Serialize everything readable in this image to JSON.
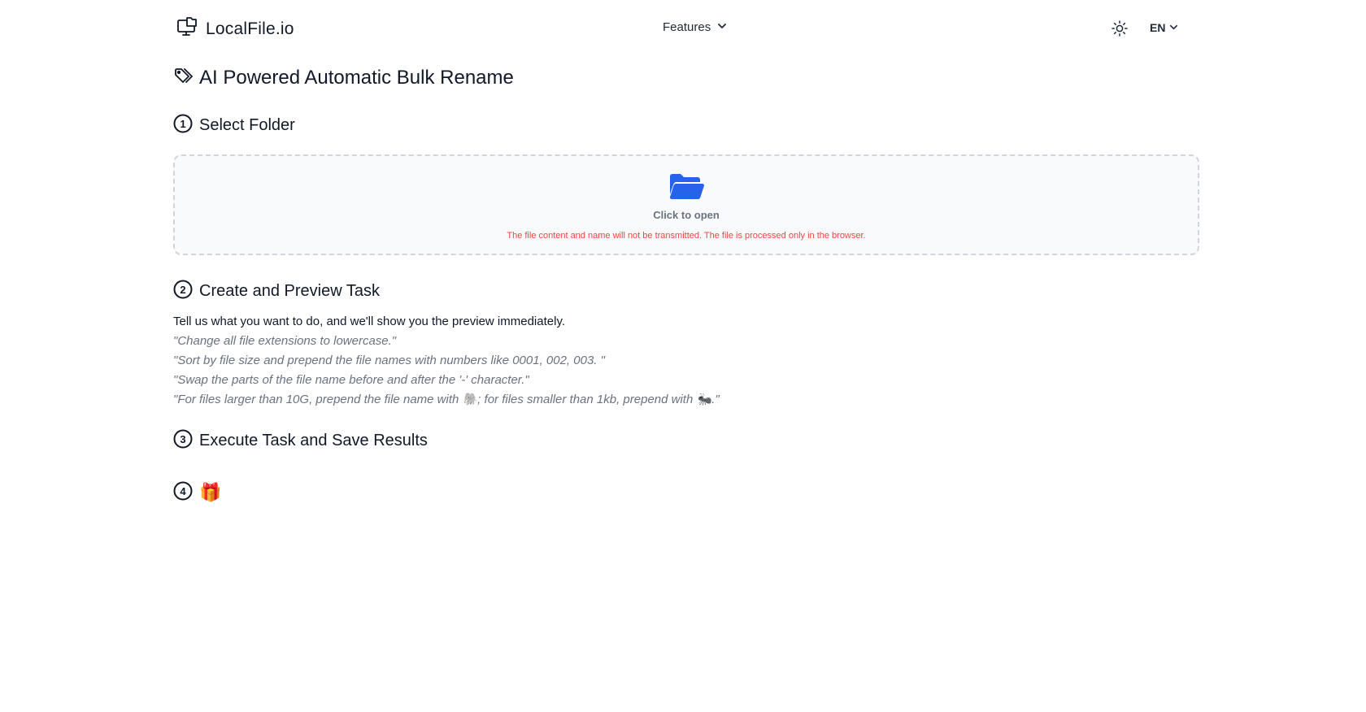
{
  "header": {
    "logo_text": "LocalFile.io",
    "nav_features": "Features",
    "language": "EN"
  },
  "page": {
    "title": "AI Powered Automatic Bulk Rename"
  },
  "steps": [
    {
      "number": "1",
      "label": "Select Folder"
    },
    {
      "number": "2",
      "label": "Create and Preview Task"
    },
    {
      "number": "3",
      "label": "Execute Task and Save Results"
    },
    {
      "number": "4",
      "label": "🎁"
    }
  ],
  "dropzone": {
    "click_text": "Click to open",
    "privacy_note": "The file content and name will not be transmitted. The file is processed only in the browser."
  },
  "task": {
    "intro": "Tell us what you want to do, and we'll show you the preview immediately.",
    "examples": [
      "\"Change all file extensions to lowercase.\"",
      "\"Sort by file size and prepend the file names with numbers like 0001, 002, 003. \"",
      "\"Swap the parts of the file name before and after the '-' character.\"",
      "\"For files larger than 10G, prepend the file name with 🐘; for files smaller than 1kb, prepend with 🐜.\""
    ]
  },
  "colors": {
    "accent": "#2563eb",
    "warning": "#ef4444",
    "muted": "#6b7280"
  },
  "icons": {
    "logo": "monitor-folder-icon",
    "features_chevron": "chevron-down-icon",
    "theme": "sun-icon",
    "lang_chevron": "chevron-down-icon",
    "title": "tags-icon",
    "dropzone": "folder-open-icon"
  }
}
